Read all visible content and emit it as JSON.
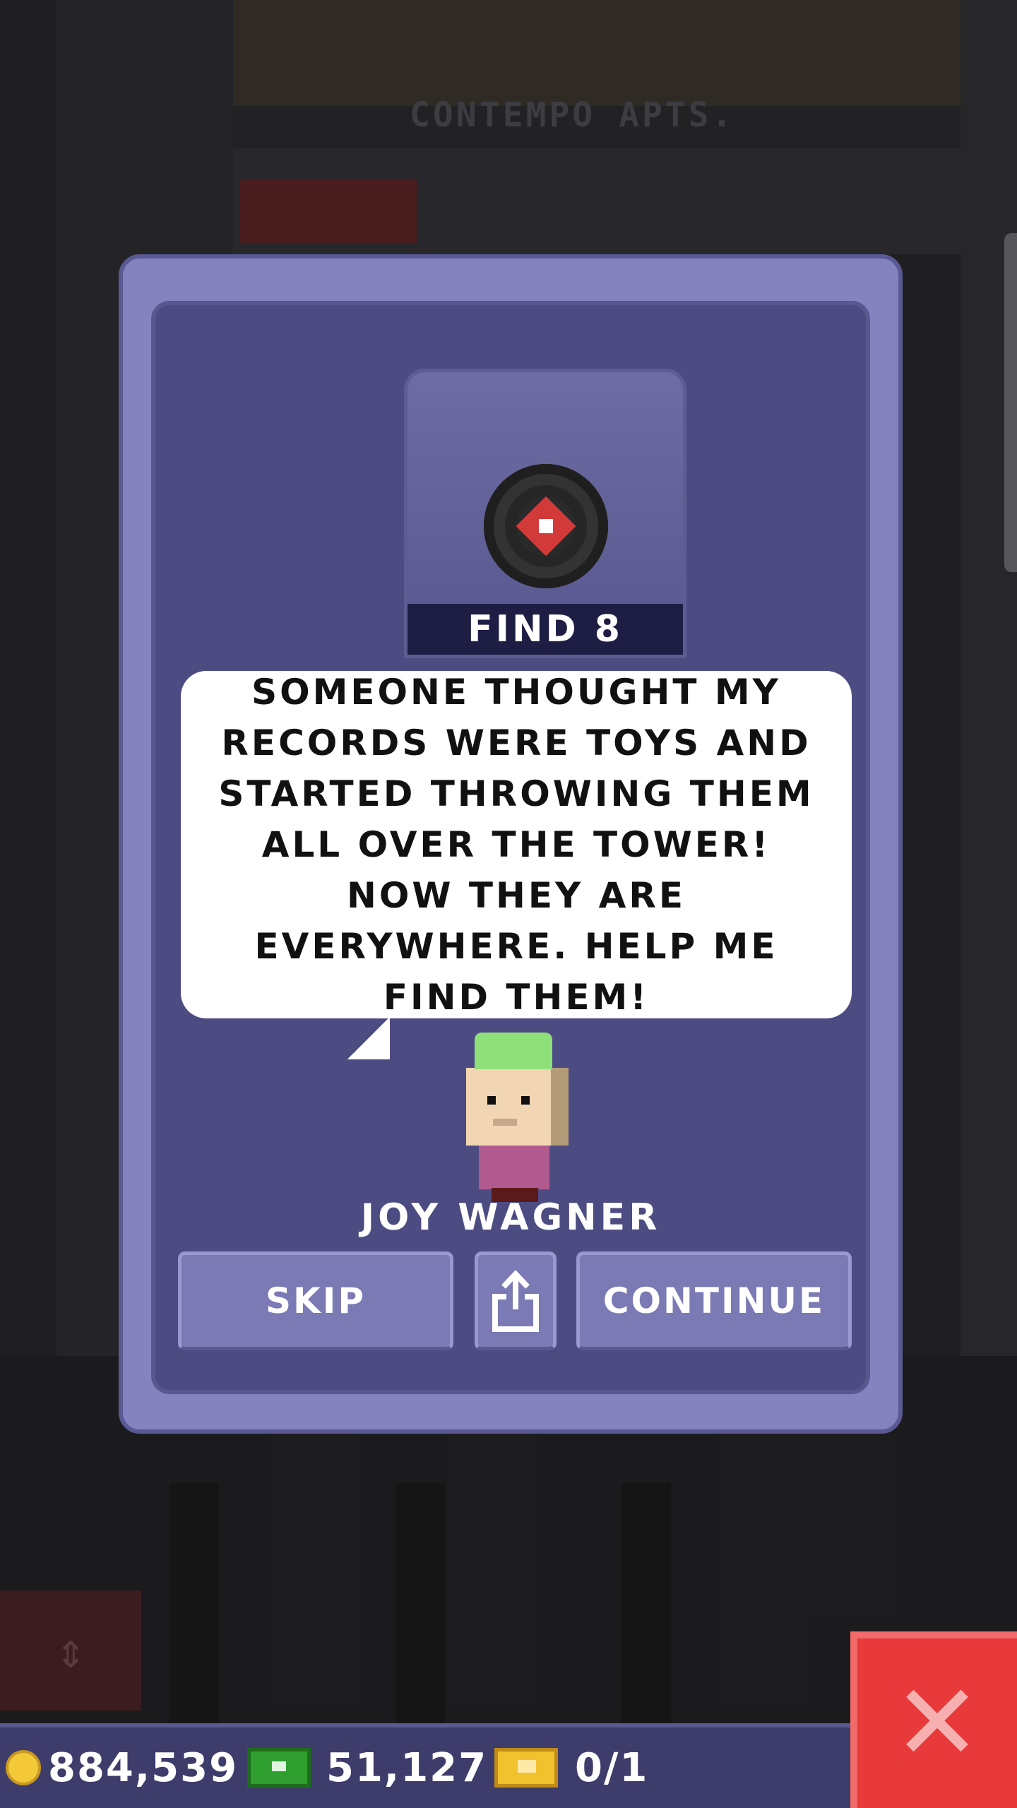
{
  "background": {
    "building_sign": "CONTEMPO APTS."
  },
  "quest": {
    "find_label": "FIND 8",
    "item_icon": "vinyl-record-icon",
    "message": "SOMEONE THOUGHT MY RECORDS WERE TOYS AND STARTED THROWING THEM ALL OVER THE TOWER! NOW THEY ARE EVERYWHERE. HELP ME FIND THEM!",
    "character_name": "JOY WAGNER"
  },
  "buttons": {
    "skip": "SKIP",
    "share_icon": "share-icon",
    "continue": "CONTINUE"
  },
  "status": {
    "coins": "884,539",
    "bux": "51,127",
    "tickets": "0/1"
  },
  "colors": {
    "dialog": "#8483c0",
    "panel": "#4d4c82",
    "close_button": "#e83a3a",
    "coin": "#f3c93a",
    "bux": "#2f9f2f"
  }
}
